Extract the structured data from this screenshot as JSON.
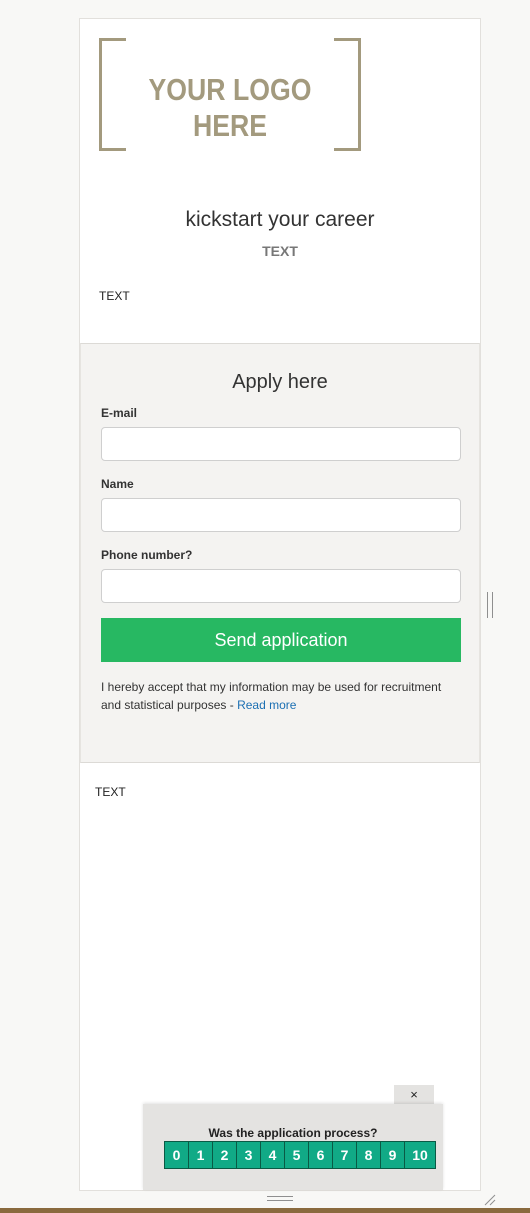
{
  "logo": {
    "text": "YOUR LOGO HERE"
  },
  "header": {
    "headline": "kickstart your career",
    "subheading": "TEXT"
  },
  "intro": {
    "text": "TEXT"
  },
  "form": {
    "title": "Apply here",
    "fields": [
      {
        "label": "E-mail",
        "value": ""
      },
      {
        "label": "Name",
        "value": ""
      },
      {
        "label": "Phone number?",
        "value": ""
      }
    ],
    "submit_label": "Send application",
    "consent_text": "I hereby accept that my information may be used for recruitment and statistical purposes - ",
    "consent_link": "Read more"
  },
  "footer": {
    "text": "TEXT"
  },
  "survey": {
    "close_label": "×",
    "question": "Was the application process?",
    "scale": [
      "0",
      "1",
      "2",
      "3",
      "4",
      "5",
      "6",
      "7",
      "8",
      "9",
      "10"
    ]
  },
  "colors": {
    "accent_green": "#27b862",
    "survey_teal": "#11aa86",
    "logo_tan": "#a39a7e",
    "link_blue": "#1b6fb3"
  },
  "icons": [
    "close-icon",
    "resize-grip-icon",
    "drag-handle-icon"
  ]
}
